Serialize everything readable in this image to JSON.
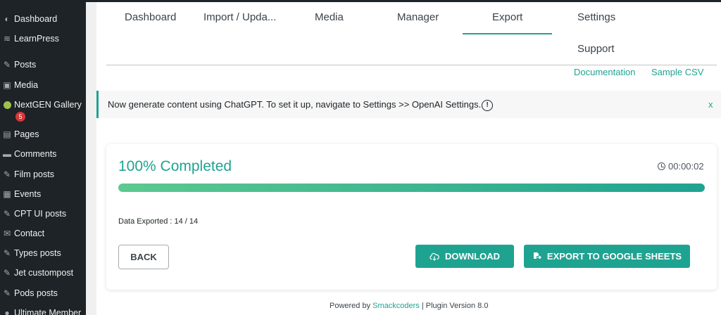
{
  "sidebar": {
    "items": [
      {
        "label": "Dashboard",
        "icon": "dashboard-icon"
      },
      {
        "label": "LearnPress",
        "icon": "learnpress-icon"
      },
      {
        "label": "Posts",
        "icon": "pin-icon"
      },
      {
        "label": "Media",
        "icon": "media-icon"
      },
      {
        "label": "NextGEN Gallery",
        "icon": "nextgen-icon",
        "badge": "5"
      },
      {
        "label": "Pages",
        "icon": "pages-icon"
      },
      {
        "label": "Comments",
        "icon": "comment-icon"
      },
      {
        "label": "Film posts",
        "icon": "pin-icon"
      },
      {
        "label": "Events",
        "icon": "calendar-icon"
      },
      {
        "label": "CPT UI posts",
        "icon": "pin-icon"
      },
      {
        "label": "Contact",
        "icon": "mail-icon"
      },
      {
        "label": "Types posts",
        "icon": "pin-icon"
      },
      {
        "label": "Jet custompost",
        "icon": "pin-icon"
      },
      {
        "label": "Pods posts",
        "icon": "pin-icon"
      },
      {
        "label": "Ultimate Member",
        "icon": "user-icon"
      }
    ]
  },
  "tabs": {
    "dashboard": "Dashboard",
    "import": "Import / Upda...",
    "media": "Media",
    "manager": "Manager",
    "export": "Export",
    "settings": "Settings",
    "support": "Support",
    "active": "Export"
  },
  "links": {
    "documentation": "Documentation",
    "sample_csv": "Sample CSV"
  },
  "notice": {
    "text": "Now generate content using ChatGPT. To set it up, navigate to Settings >> OpenAI Settings.",
    "info_glyph": "!",
    "close": "x"
  },
  "progress": {
    "title": "100% Completed",
    "timer": "00:00:02",
    "percent": 100,
    "exported_text": "Data Exported : 14 / 14"
  },
  "buttons": {
    "back": "BACK",
    "download": "DOWNLOAD",
    "export_gsheets": "EXPORT TO GOOGLE SHEETS"
  },
  "footer": {
    "prefix": "Powered by",
    "brand": "Smackcoders",
    "suffix": "| Plugin Version 8.0"
  },
  "colors": {
    "accent": "#1fa391",
    "sidebar_bg": "#1d2327",
    "badge": "#d63638"
  }
}
